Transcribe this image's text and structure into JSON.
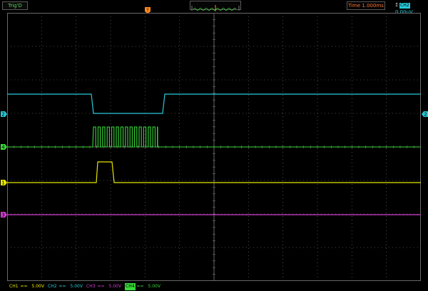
{
  "top": {
    "trigger_label": "Trig'D",
    "time_label": "Time 1.000ms",
    "trigger_channel": "CH2",
    "trigger_level": "0.00uV"
  },
  "channels": [
    {
      "name": "CH1",
      "scale": "5.00V",
      "color": "#e6e600"
    },
    {
      "name": "CH2",
      "scale": "5.00V",
      "color": "#27c8d8"
    },
    {
      "name": "CH3",
      "scale": "5.00V",
      "color": "#d23cd2"
    },
    {
      "name": "CH4",
      "scale": "5.00V",
      "color": "#39d839"
    }
  ],
  "markers": {
    "ch1": "1",
    "ch2": "2",
    "ch3": "3",
    "ch4": "4",
    "trigger": "T"
  },
  "colors": {
    "grid": "#4a4a4a",
    "grid_dot": "#5c5c5c",
    "frame": "#6a6a6a",
    "trigger_marker": "#ff8a1e"
  }
}
